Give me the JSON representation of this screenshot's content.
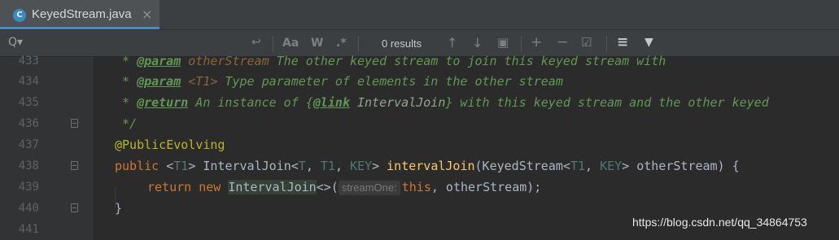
{
  "tab": {
    "icon_letter": "C",
    "filename": "KeyedStream.java",
    "close": "×"
  },
  "findbar": {
    "search_icon": "Q▾",
    "regex_wrap_icon": "↩",
    "match_case_label": "Aa",
    "words_label": "W",
    "regex_label": ".*",
    "results": "0 results",
    "prev_icon": "↑",
    "next_icon": "↓",
    "select_all_icon": "▣",
    "add_occ_icon": "+",
    "remove_occ_icon": "−",
    "select_occ_icon": "☑",
    "filter_list_icon": "≡",
    "filter_icon": "▼"
  },
  "lines": [
    {
      "num": "433"
    },
    {
      "num": "434"
    },
    {
      "num": "435"
    },
    {
      "num": "436"
    },
    {
      "num": "437"
    },
    {
      "num": "438"
    },
    {
      "num": "439"
    },
    {
      "num": "440"
    },
    {
      "num": "441"
    }
  ],
  "code": {
    "l433_star": "* ",
    "l433_tag": "@param",
    "l433_param": " otherStream",
    "l433_rest": " The other keyed stream to join this keyed stream with",
    "l434_star": "* ",
    "l434_tag": "@param",
    "l434_param": " <T1>",
    "l434_rest": " Type parameter of elements in the other stream",
    "l435_star": "* ",
    "l435_tag": "@return",
    "l435_rest1": " An instance of {",
    "l435_link": "@link",
    "l435_rest2": " IntervalJoin",
    "l435_rest3": "} with this keyed stream and the other keyed",
    "l436": "*/",
    "l437": "@PublicEvolving",
    "l438_public": "public",
    "l438_a": " <",
    "l438_t1": "T1",
    "l438_b": "> IntervalJoin<",
    "l438_t": "T",
    "l438_c": ", ",
    "l438_t1b": "T1",
    "l438_d": ", ",
    "l438_key": "KEY",
    "l438_e": "> ",
    "l438_fn": "intervalJoin",
    "l438_f": "(KeyedStream<",
    "l438_t1c": "T1",
    "l438_g": ", ",
    "l438_key2": "KEY",
    "l438_h": "> otherStream) {",
    "l439_return": "return",
    "l439_sp": " ",
    "l439_new": "new",
    "l439_sp2": " ",
    "l439_cls": "IntervalJoin",
    "l439_a": "<>(",
    "l439_hint": "streamOne:",
    "l439_this": "this",
    "l439_b": ", otherStream);",
    "l440": "}"
  },
  "watermark": "https://blog.csdn.net/qq_34864753"
}
